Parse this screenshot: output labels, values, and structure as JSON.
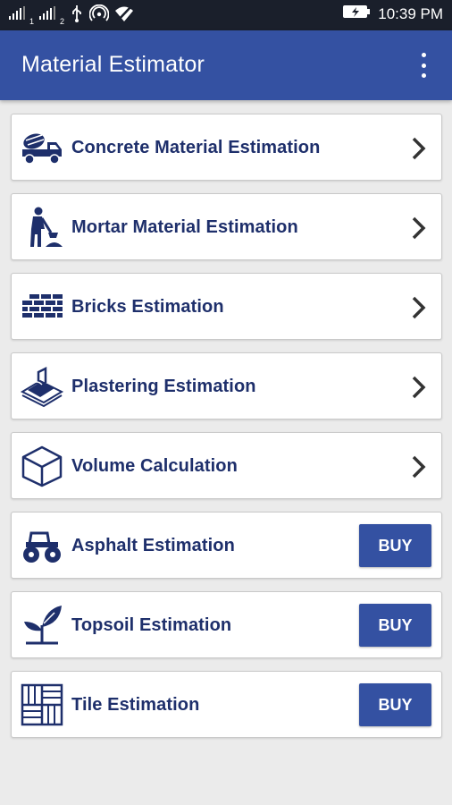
{
  "status_bar": {
    "sim1": "1",
    "sim2": "2",
    "time": "10:39 PM"
  },
  "app_bar": {
    "title": "Material Estimator"
  },
  "items": [
    {
      "label": "Concrete Material Estimation",
      "icon": "concrete-mixer-truck-icon",
      "action": "chevron"
    },
    {
      "label": "Mortar Material Estimation",
      "icon": "worker-shoveling-icon",
      "action": "chevron"
    },
    {
      "label": "Bricks Estimation",
      "icon": "brick-wall-icon",
      "action": "chevron"
    },
    {
      "label": "Plastering Estimation",
      "icon": "plastering-trowel-icon",
      "action": "chevron"
    },
    {
      "label": "Volume Calculation",
      "icon": "cube-icon",
      "action": "chevron"
    },
    {
      "label": "Asphalt Estimation",
      "icon": "road-roller-icon",
      "action": "BUY"
    },
    {
      "label": "Topsoil Estimation",
      "icon": "plant-sprout-icon",
      "action": "BUY"
    },
    {
      "label": "Tile Estimation",
      "icon": "tile-pattern-icon",
      "action": "BUY"
    }
  ],
  "colors": {
    "primary": "#3451a2",
    "label_text": "#1e2f6b",
    "status_bar": "#1a1f2b",
    "background": "#ebebeb"
  }
}
